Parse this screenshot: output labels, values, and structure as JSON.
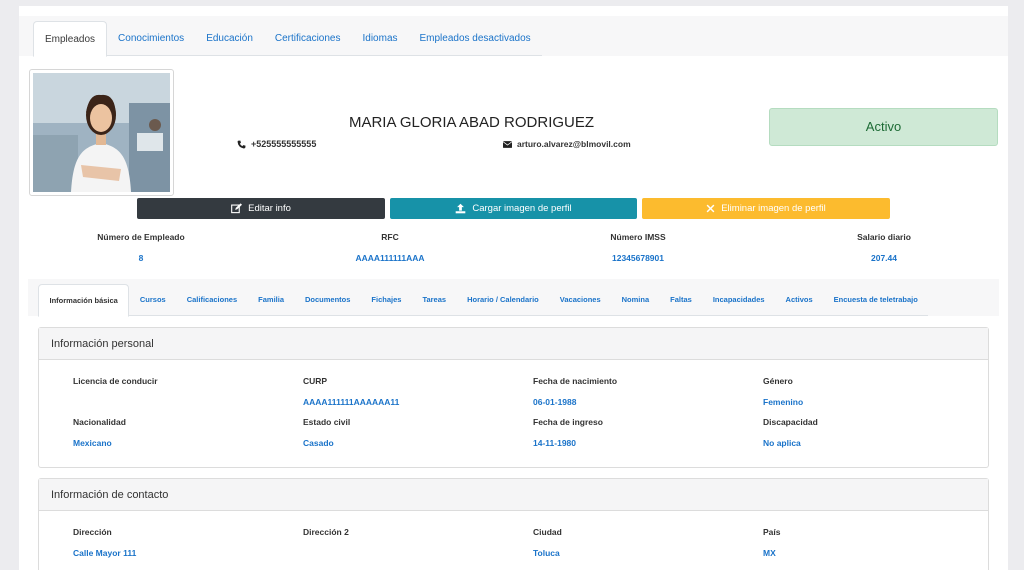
{
  "top_tabs": [
    "Empleados",
    "Conocimientos",
    "Educación",
    "Certificaciones",
    "Idiomas",
    "Empleados desactivados"
  ],
  "employee": {
    "name": "MARIA GLORIA ABAD RODRIGUEZ",
    "phone": "+525555555555",
    "email": "arturo.alvarez@blmovil.com",
    "status": "Activo",
    "phone_icon": "phone-icon",
    "email_icon": "envelope-icon"
  },
  "actions": {
    "edit_label": "Editar info",
    "upload_label": "Cargar imagen de perfil",
    "delete_label": "Eliminar imagen de perfil"
  },
  "stats": [
    {
      "label": "Número de Empleado",
      "value": "8"
    },
    {
      "label": "RFC",
      "value": "AAAA111111AAA"
    },
    {
      "label": "Número IMSS",
      "value": "12345678901"
    },
    {
      "label": "Salario diario",
      "value": "207.44"
    }
  ],
  "sub_tabs": [
    "Información básica",
    "Cursos",
    "Calificaciones",
    "Familia",
    "Documentos",
    "Fichajes",
    "Tareas",
    "Horario / Calendario",
    "Vacaciones",
    "Nomina",
    "Faltas",
    "Incapacidades",
    "Activos",
    "Encuesta de teletrabajo"
  ],
  "personal": {
    "title": "Información personal",
    "fields": [
      {
        "label": "Licencia de conducir",
        "value": ""
      },
      {
        "label": "CURP",
        "value": "AAAA111111AAAAAA11"
      },
      {
        "label": "Fecha de nacimiento",
        "value": "06-01-1988"
      },
      {
        "label": "Género",
        "value": "Femenino"
      },
      {
        "label": "Nacionalidad",
        "value": "Mexicano"
      },
      {
        "label": "Estado civil",
        "value": "Casado"
      },
      {
        "label": "Fecha de ingreso",
        "value": "14-11-1980"
      },
      {
        "label": "Discapacidad",
        "value": "No aplica"
      }
    ]
  },
  "contact": {
    "title": "Información de contacto",
    "fields": [
      {
        "label": "Dirección",
        "value": "Calle Mayor 111"
      },
      {
        "label": "Dirección 2",
        "value": ""
      },
      {
        "label": "Ciudad",
        "value": "Toluca"
      },
      {
        "label": "País",
        "value": "MX"
      }
    ]
  },
  "colors": {
    "link": "#1a73c9",
    "status_bg": "#cfe9d6",
    "edit": "#343a40",
    "upload": "#1792a8",
    "delete": "#fcbb2e"
  }
}
